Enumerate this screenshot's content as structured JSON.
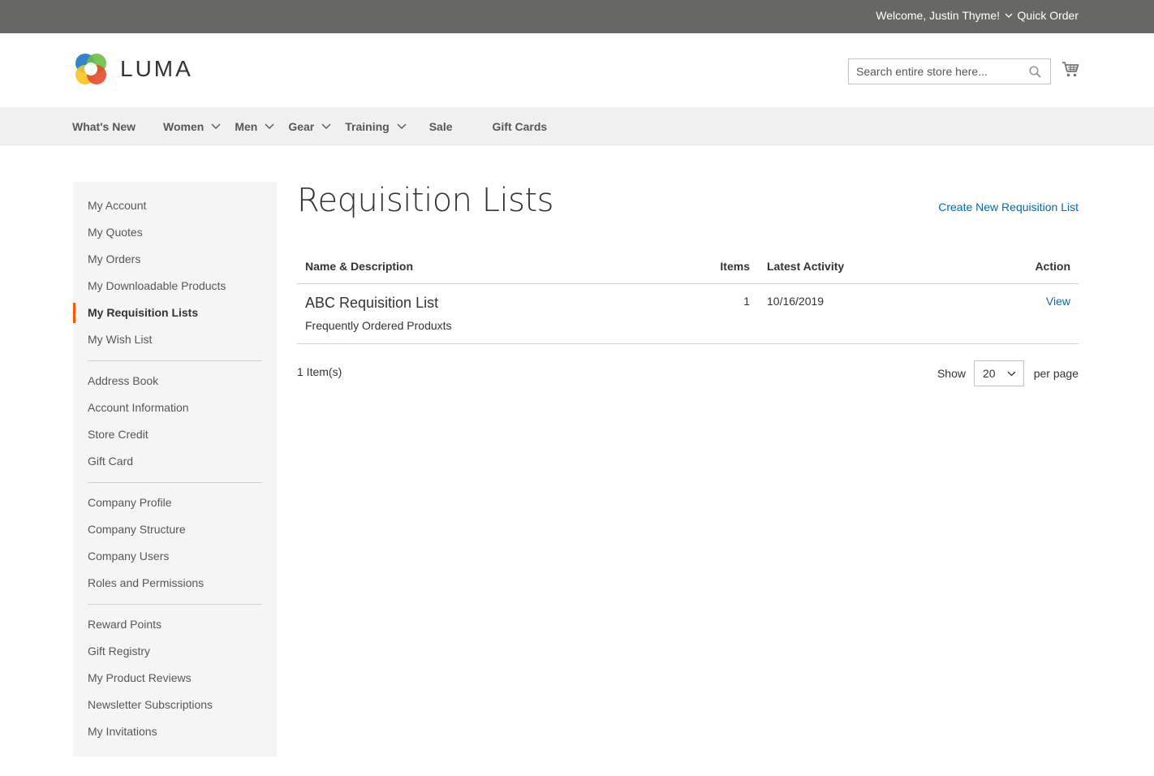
{
  "topbar": {
    "welcome": "Welcome, Justin Thyme!",
    "quick_order": "Quick Order"
  },
  "header": {
    "logo_text": "LUMA",
    "search_placeholder": "Search entire store here...",
    "icons": [
      "search-icon",
      "cart-icon"
    ]
  },
  "nav": {
    "items": [
      {
        "label": "What's New",
        "has_submenu": false
      },
      {
        "label": "Women",
        "has_submenu": true
      },
      {
        "label": "Men",
        "has_submenu": true
      },
      {
        "label": "Gear",
        "has_submenu": true
      },
      {
        "label": "Training",
        "has_submenu": true
      },
      {
        "label": "Sale",
        "has_submenu": false
      },
      {
        "label": "Gift Cards",
        "has_submenu": false
      }
    ]
  },
  "sidebar": {
    "groups": [
      [
        "My Account",
        "My Quotes",
        "My Orders",
        "My Downloadable Products",
        "My Requisition Lists",
        "My Wish List"
      ],
      [
        "Address Book",
        "Account Information",
        "Store Credit",
        "Gift Card"
      ],
      [
        "Company Profile",
        "Company Structure",
        "Company Users",
        "Roles and Permissions"
      ],
      [
        "Reward Points",
        "Gift Registry",
        "My Product Reviews",
        "Newsletter Subscriptions",
        "My Invitations"
      ]
    ],
    "active": "My Requisition Lists",
    "accent_color": "#ff5501"
  },
  "main": {
    "title": "Requisition Lists",
    "create_link": "Create New Requisition List",
    "table": {
      "headers": {
        "name": "Name & Description",
        "items": "Items",
        "activity": "Latest Activity",
        "action": "Action"
      },
      "rows": [
        {
          "name": "ABC Requisition List",
          "description": "Frequently Ordered Produxts",
          "items": "1",
          "activity": "10/16/2019",
          "action": "View"
        }
      ]
    },
    "toolbar": {
      "count": "1 Item(s)",
      "show_label": "Show",
      "limiter_value": "20",
      "per_page_label": "per page"
    }
  },
  "colors": {
    "topbar": "#676865",
    "nav_bg": "#f0f0f0",
    "link": "#006bb4"
  }
}
